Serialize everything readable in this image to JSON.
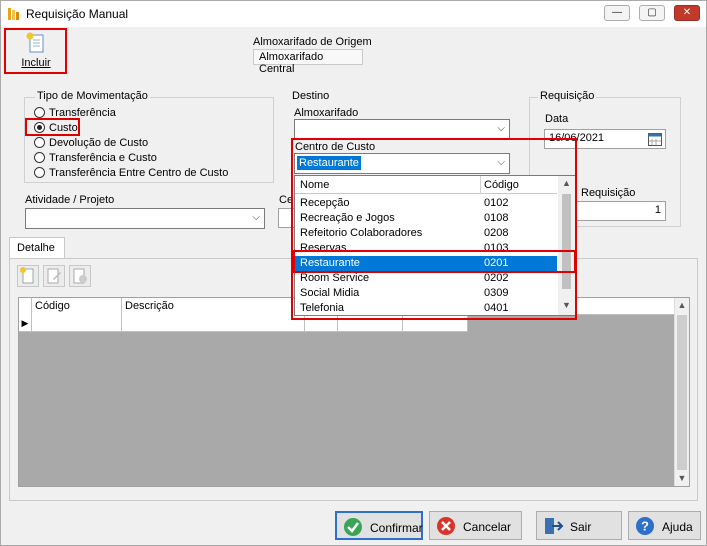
{
  "window": {
    "title": "Requisição Manual",
    "controls": {
      "minimize": "—",
      "maximize": "▢",
      "close": "✕"
    }
  },
  "toolbar": {
    "incluir_label": "Incluir",
    "origem_label": "Almoxarifado de Origem",
    "origem_value": "Almoxarifado Central"
  },
  "movimentacao": {
    "title": "Tipo de Movimentação",
    "options": [
      "Transferência",
      "Custo",
      "Devolução de Custo",
      "Transferência e Custo",
      "Transferência Entre Centro de Custo"
    ],
    "selected_index": 1
  },
  "destino": {
    "title": "Destino",
    "almoxarifado_label": "Almoxarifado",
    "almoxarifado_value": "",
    "centro_label": "Centro de Custo",
    "centro_value": "Restaurante"
  },
  "requisicao": {
    "title": "Requisição",
    "data_label": "Data",
    "data_value": "16/06/2021",
    "numero_label": "Requisição",
    "numero_value": "1"
  },
  "atividade": {
    "label": "Atividade / Projeto",
    "value": ""
  },
  "hidden_label_fragment": "Ce",
  "tabs": {
    "detalhe": "Detalhe"
  },
  "grid": {
    "columns": [
      "Código",
      "Descrição"
    ]
  },
  "dropdown": {
    "columns": [
      "Nome",
      "Código"
    ],
    "rows": [
      {
        "nome": "Recepção",
        "codigo": "0102"
      },
      {
        "nome": "Recreação e Jogos",
        "codigo": "0108"
      },
      {
        "nome": "Refeitorio Colaboradores",
        "codigo": "0208"
      },
      {
        "nome": "Reservas",
        "codigo": "0103"
      },
      {
        "nome": "Restaurante",
        "codigo": "0201"
      },
      {
        "nome": "Room Service",
        "codigo": "0202"
      },
      {
        "nome": "Social Midia",
        "codigo": "0309"
      },
      {
        "nome": "Telefonia",
        "codigo": "0401"
      }
    ],
    "selected_index": 4
  },
  "buttons": {
    "confirmar": "Confirmar",
    "cancelar": "Cancelar",
    "sair": "Sair",
    "ajuda": "Ajuda"
  },
  "colors": {
    "highlight_box": "#e00000",
    "selection": "#0078d7",
    "close_button": "#c0392b"
  }
}
